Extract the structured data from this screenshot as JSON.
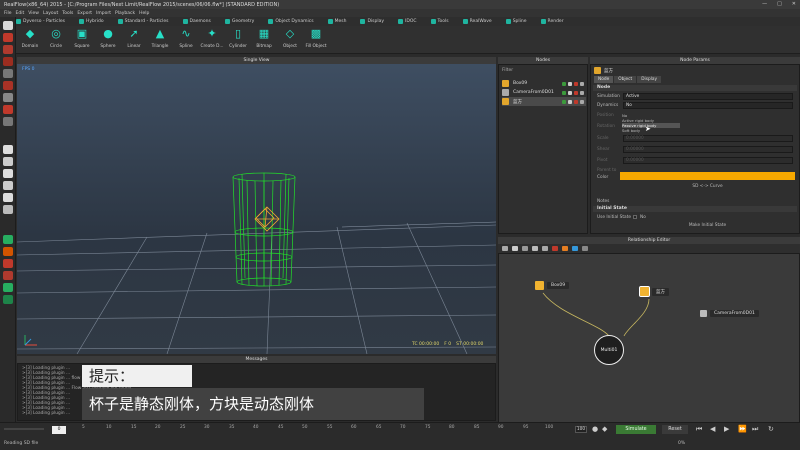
{
  "window": {
    "title": "RealFlow(x86_64) 2015 - [C:/Program Files/Next Limit/RealFlow 2015/scenes/06/06.flw*] (STANDARD EDITION)"
  },
  "menubar": [
    "File",
    "Edit",
    "View",
    "Layout",
    "Tools",
    "Export",
    "Import",
    "Playback",
    "Help"
  ],
  "shelf": {
    "tabs": [
      "Dyverso - Particles",
      "Hybrido",
      "Standard - Particles",
      "Daemons",
      "Geometry",
      "Object Dynamics",
      "Mesh",
      "Display",
      "IDOC",
      "Tools",
      "RealWave",
      "Spline",
      "Render"
    ],
    "tools": [
      "Domain",
      "Circle",
      "Square",
      "Sphere",
      "Linear",
      "Triangle",
      "Spline",
      "Create D...",
      "Cylinder",
      "Bitmap",
      "Object",
      "Fill Object"
    ]
  },
  "viewport": {
    "title": "Single View",
    "stats": "FPS 0",
    "time": [
      "TC 00:00:00",
      "F 0",
      "ST 00:00:00"
    ]
  },
  "nodes": {
    "title": "Nodes",
    "filter": "Filter",
    "items": [
      {
        "name": "Box09",
        "icon": "cube-icon",
        "selected": false
      },
      {
        "name": "CameraFrom0D01",
        "icon": "camera-icon",
        "selected": false
      },
      {
        "name": "蓝方",
        "icon": "cube-icon",
        "selected": true
      }
    ]
  },
  "node_params": {
    "title": "Node Params",
    "node_name": "蓝方",
    "tabs": [
      "Node",
      "Object",
      "Display"
    ],
    "section_node": "Node",
    "rows": [
      {
        "label": "Simulation",
        "value": "Active",
        "dim": false
      },
      {
        "label": "Dynamics",
        "value": "No",
        "dim": false
      },
      {
        "label": "Position",
        "value": "",
        "dim": true
      },
      {
        "label": "Rotation",
        "value": "",
        "dim": true
      },
      {
        "label": "Scale",
        "value": "0.00000",
        "dim": true
      },
      {
        "label": "Shear",
        "value": "0.00000",
        "dim": true
      },
      {
        "label": "Pivot",
        "value": "0.00000",
        "dim": true
      },
      {
        "label": "Parent to",
        "value": "",
        "dim": true
      },
      {
        "label": "Color",
        "value": "",
        "dim": false
      }
    ],
    "dropdown_options": [
      "No",
      "Active rigid body",
      "Passive rigid body",
      "Soft body"
    ],
    "color": "#f7a800",
    "sd_curve": "SD <-> Curve",
    "notes_label": "Notes",
    "section_initial": "Initial State",
    "use_initial_label": "Use Initial State",
    "use_initial_value": "No",
    "make_initial": "Make Initial State"
  },
  "relationship": {
    "title": "Relationship Editor",
    "nodes": {
      "box09": "Box09",
      "blue": "蓝方",
      "camera": "CameraFrom0D01",
      "multi": "Multi01"
    }
  },
  "messages": {
    "title": "Messages",
    "lines": [
      ">[3] Loading plugin ...",
      ">[3] Loading plugin ...",
      ">[3] Loading plugin ... flow 2015/plugins/ /rfs not found.",
      ">[3] Loading plugin ...",
      ">[3] Loading plugin ... Flow 2015/simple not found.",
      ">[3] Loading plugin ...",
      ">[3] Loading plugin ...",
      ">[3] Loading plugin ...",
      ">[3] Loading plugin ...",
      ">[3] Loading plugin ..."
    ]
  },
  "caption": {
    "hint": "提示：",
    "text": "杯子是静态刚体，方块是动态刚体"
  },
  "timeline": {
    "frame": "0",
    "ticks": [
      "5",
      "10",
      "15",
      "20",
      "25",
      "30",
      "35",
      "40",
      "45",
      "50",
      "55",
      "60",
      "65",
      "70",
      "75",
      "80",
      "85",
      "90",
      "95",
      "100"
    ],
    "end_frame": "100",
    "simulate": "Simulate",
    "reset": "Reset"
  },
  "status": {
    "text": "Reading SD file",
    "progress": "0%"
  }
}
